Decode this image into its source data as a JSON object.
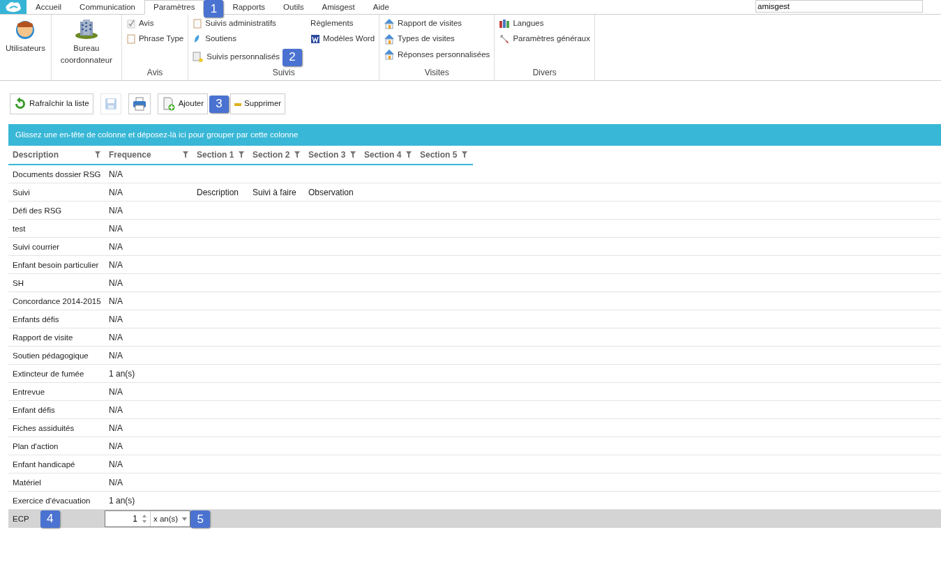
{
  "menu_tabs": [
    {
      "label": "Accueil",
      "selected": false
    },
    {
      "label": "Communication",
      "selected": false
    },
    {
      "label": "Paramètres",
      "selected": true,
      "callout": "1"
    },
    {
      "label": "Rapports",
      "selected": false
    },
    {
      "label": "Outils",
      "selected": false
    },
    {
      "label": "Amisgest",
      "selected": false
    },
    {
      "label": "Aide",
      "selected": false
    }
  ],
  "search": {
    "value": "amisgest"
  },
  "ribbon_groups": [
    {
      "kind": "large",
      "items": [
        {
          "label": "Utilisateurs"
        }
      ]
    },
    {
      "kind": "large",
      "items": [
        {
          "label": "Bureau coordonnateur"
        }
      ]
    },
    {
      "title": "Avis",
      "kind": "small",
      "items": [
        {
          "label": "Avis"
        },
        {
          "label": "Phrase Type"
        }
      ]
    },
    {
      "title": "Suivis",
      "kind": "small",
      "items": [
        {
          "label": "Suivis administratifs"
        },
        {
          "label": "Soutiens"
        },
        {
          "label": "Suivis personnalisés",
          "callout": "2"
        },
        {
          "label": "Règlements"
        },
        {
          "label": "Modèles Word"
        }
      ]
    },
    {
      "title": "Visites",
      "kind": "small",
      "items": [
        {
          "label": "Rapport de visites"
        },
        {
          "label": "Types de visites"
        },
        {
          "label": "Réponses personnalisées"
        }
      ]
    },
    {
      "title": "Divers",
      "kind": "small",
      "items": [
        {
          "label": "Langues"
        },
        {
          "label": "Paramètres généraux"
        }
      ]
    }
  ],
  "toolbar": [
    {
      "label": "Rafraîchir la liste",
      "disabled": false
    },
    {
      "disabled": true
    },
    {
      "disabled": false
    },
    {
      "label": "Ajouter",
      "disabled": false,
      "callout": "3"
    },
    {
      "label": "Supprimer",
      "disabled": false
    }
  ],
  "group_panel": "Glissez une en-tête de colonne et déposez-là ici pour grouper par cette colonne",
  "table": {
    "columns": [
      "Description",
      "Frequence",
      "Section 1",
      "Section 2",
      "Section 3",
      "Section 4",
      "Section 5"
    ],
    "rows": [
      {
        "cells": [
          "Documents dossier RSG",
          "N/A"
        ]
      },
      {
        "cells": [
          "Suivi",
          "N/A",
          "Description",
          "Suivi à faire",
          "Observation"
        ]
      },
      {
        "cells": [
          "Défi des RSG",
          "N/A"
        ]
      },
      {
        "cells": [
          "test",
          "N/A"
        ]
      },
      {
        "cells": [
          "Suivi courrier",
          "N/A"
        ]
      },
      {
        "cells": [
          "Enfant besoin particulier",
          "N/A"
        ]
      },
      {
        "cells": [
          "SH",
          "N/A"
        ]
      },
      {
        "cells": [
          "Concordance 2014-2015",
          "N/A"
        ]
      },
      {
        "cells": [
          "Enfants défis",
          "N/A"
        ]
      },
      {
        "cells": [
          "Rapport de visite",
          "N/A"
        ]
      },
      {
        "cells": [
          "Soutien pédagogique",
          "N/A"
        ]
      },
      {
        "cells": [
          "Extincteur de fumée",
          "1 an(s)"
        ]
      },
      {
        "cells": [
          "Entrevue",
          "N/A"
        ]
      },
      {
        "cells": [
          "Enfant défis",
          "N/A"
        ]
      },
      {
        "cells": [
          "Fiches assiduités",
          "N/A"
        ]
      },
      {
        "cells": [
          "Plan d'action",
          "N/A"
        ]
      },
      {
        "cells": [
          "Enfant handicapé",
          "N/A"
        ]
      },
      {
        "cells": [
          "Matériel",
          "N/A"
        ]
      },
      {
        "cells": [
          "Exercice d'évacuation",
          "1 an(s)"
        ]
      }
    ],
    "edit_row": {
      "description": "ECP",
      "description_callout": "4",
      "number": "1",
      "unit": "x an(s)",
      "unit_callout": "5"
    }
  }
}
